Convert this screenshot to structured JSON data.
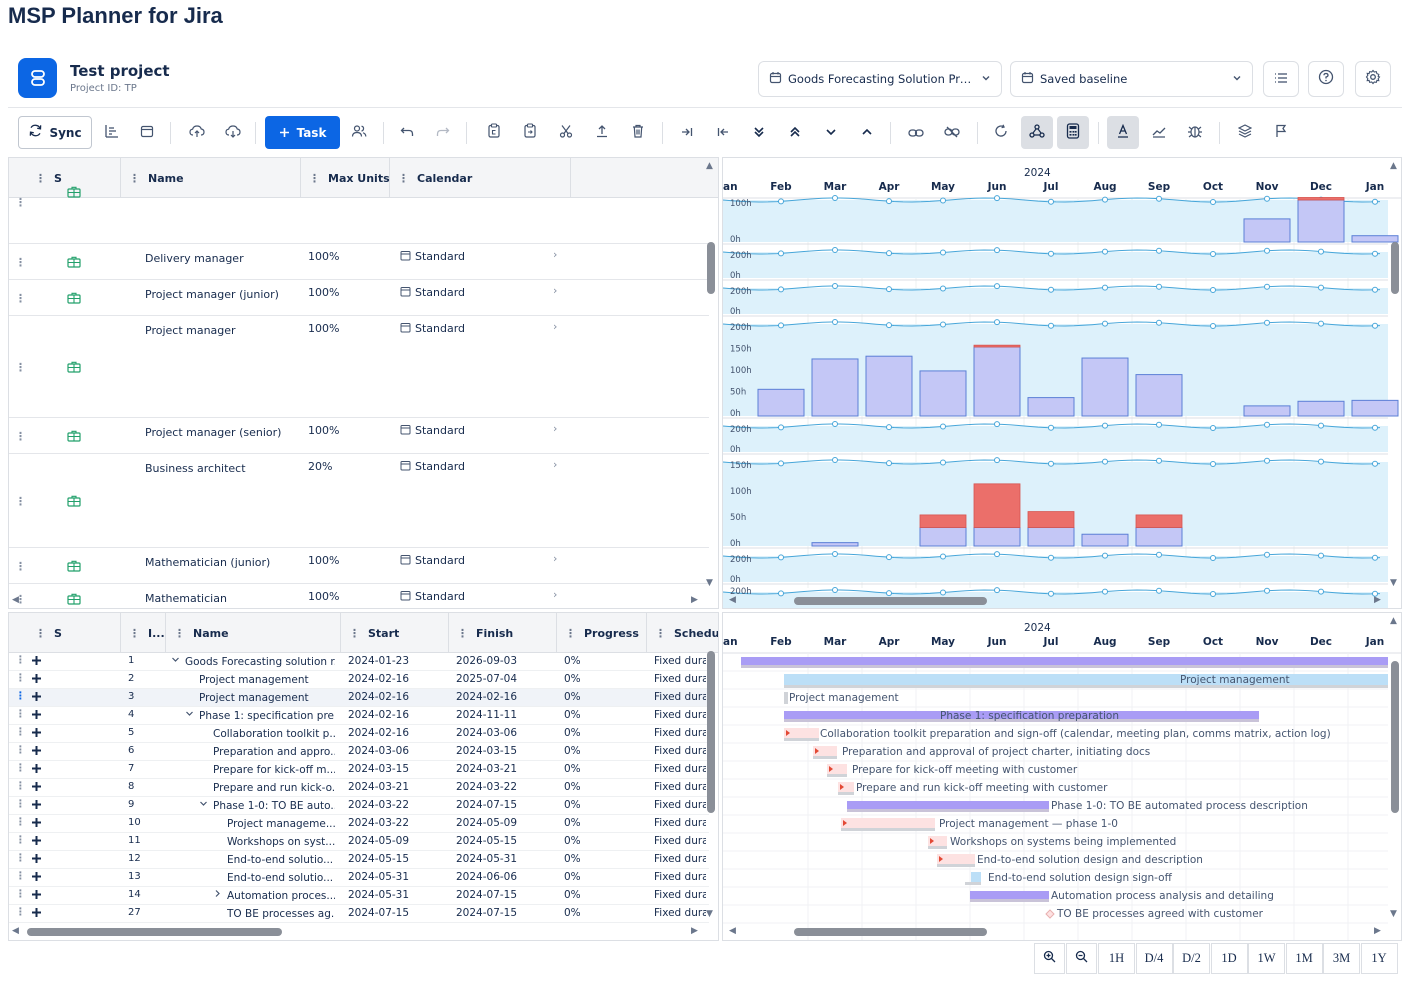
{
  "app": {
    "title": "MSP Planner for Jira"
  },
  "project": {
    "name": "Test project",
    "id_label": "Project ID: TP"
  },
  "selectors": {
    "plan": "Goods Forecasting Solution Proj...",
    "baseline": "Saved baseline"
  },
  "toolbar": {
    "sync_label": "Sync",
    "task_label": "Task"
  },
  "colors": {
    "accent": "#0c66e4",
    "capacity_fill": "#ddf1fb",
    "load_bar": "#c4c7f6",
    "overload": "#eb6f6a",
    "summary_bar": "#a99cf5",
    "task_bar": "#bcdff7"
  },
  "resource_grid": {
    "columns": [
      "S",
      "Name",
      "Max Units",
      "Calendar"
    ],
    "rows": [
      {
        "name": "",
        "units": "",
        "calendar": ""
      },
      {
        "name": "Delivery manager",
        "units": "100%",
        "calendar": "Standard"
      },
      {
        "name": "Project manager (junior)",
        "units": "100%",
        "calendar": "Standard"
      },
      {
        "name": "Project manager",
        "units": "100%",
        "calendar": "Standard"
      },
      {
        "name": "Project manager (senior)",
        "units": "100%",
        "calendar": "Standard"
      },
      {
        "name": "Business architect",
        "units": "20%",
        "calendar": "Standard"
      },
      {
        "name": "Mathematician (junior)",
        "units": "100%",
        "calendar": "Standard"
      },
      {
        "name": "Mathematician",
        "units": "100%",
        "calendar": "Standard"
      }
    ]
  },
  "task_grid": {
    "columns": [
      "S",
      "I...",
      "Name",
      "Start",
      "Finish",
      "Progress",
      "Schedu"
    ],
    "rows": [
      {
        "id": "1",
        "name": "Goods Forecasting solution r...",
        "start": "2024-01-23",
        "finish": "2026-09-03",
        "progress": "0%",
        "sched": "Fixed dura"
      },
      {
        "id": "2",
        "name": "Project management",
        "start": "2024-02-16",
        "finish": "2025-07-04",
        "progress": "0%",
        "sched": "Fixed dura"
      },
      {
        "id": "3",
        "name": "Project management",
        "start": "2024-02-16",
        "finish": "2024-02-16",
        "progress": "0%",
        "sched": "Fixed dura"
      },
      {
        "id": "4",
        "name": "Phase 1: specification pre...",
        "start": "2024-02-16",
        "finish": "2024-11-11",
        "progress": "0%",
        "sched": "Fixed dura"
      },
      {
        "id": "5",
        "name": "Collaboration toolkit p...",
        "start": "2024-02-16",
        "finish": "2024-03-06",
        "progress": "0%",
        "sched": "Fixed dura"
      },
      {
        "id": "6",
        "name": "Preparation and appro...",
        "start": "2024-03-06",
        "finish": "2024-03-15",
        "progress": "0%",
        "sched": "Fixed dura"
      },
      {
        "id": "7",
        "name": "Prepare for kick-off m...",
        "start": "2024-03-15",
        "finish": "2024-03-21",
        "progress": "0%",
        "sched": "Fixed dura"
      },
      {
        "id": "8",
        "name": "Prepare and run kick-o...",
        "start": "2024-03-21",
        "finish": "2024-03-22",
        "progress": "0%",
        "sched": "Fixed dura"
      },
      {
        "id": "9",
        "name": "Phase 1-0: TO BE auto...",
        "start": "2024-03-22",
        "finish": "2024-07-15",
        "progress": "0%",
        "sched": "Fixed dura"
      },
      {
        "id": "10",
        "name": "Project manageme...",
        "start": "2024-03-22",
        "finish": "2024-05-09",
        "progress": "0%",
        "sched": "Fixed dura"
      },
      {
        "id": "11",
        "name": "Workshops on syst...",
        "start": "2024-05-09",
        "finish": "2024-05-15",
        "progress": "0%",
        "sched": "Fixed dura"
      },
      {
        "id": "12",
        "name": "End-to-end solutio...",
        "start": "2024-05-15",
        "finish": "2024-05-31",
        "progress": "0%",
        "sched": "Fixed dura"
      },
      {
        "id": "13",
        "name": "End-to-end solutio...",
        "start": "2024-05-31",
        "finish": "2024-06-06",
        "progress": "0%",
        "sched": "Fixed dura"
      },
      {
        "id": "14",
        "name": "Automation proces...",
        "start": "2024-05-31",
        "finish": "2024-07-15",
        "progress": "0%",
        "sched": "Fixed dura"
      },
      {
        "id": "27",
        "name": "TO BE processes ag...",
        "start": "2024-07-15",
        "finish": "2024-07-15",
        "progress": "0%",
        "sched": "Fixed dura"
      }
    ]
  },
  "timeline": {
    "year": "2024",
    "months_top": [
      "an",
      "Feb",
      "Mar",
      "Apr",
      "May",
      "Jun",
      "Jul",
      "Aug",
      "Sep",
      "Oct",
      "Nov",
      "Dec",
      "Jan"
    ],
    "months_bottom": [
      "an",
      "Feb",
      "Mar",
      "Apr",
      "May",
      "Jun",
      "Jul",
      "Aug",
      "Sep",
      "Oct",
      "Nov",
      "Dec",
      "Jan"
    ]
  },
  "histogram_tracks": [
    {
      "ticks": [
        "100h",
        "0h"
      ],
      "bars": [],
      "tail_bars": [
        {
          "month": 10,
          "load": 0.55
        },
        {
          "month": 11,
          "load": 1.0,
          "over": 0.06
        },
        {
          "month": 12,
          "load": 0.15
        }
      ]
    },
    {
      "ticks": [
        "200h",
        "0h"
      ],
      "bars": []
    },
    {
      "ticks": [
        "200h",
        "0h"
      ],
      "bars": []
    },
    {
      "ticks": [
        "200h",
        "150h",
        "100h",
        "50h",
        "0h"
      ],
      "bars": [
        {
          "month": 1,
          "load": 0.29
        },
        {
          "month": 2,
          "load": 0.62
        },
        {
          "month": 3,
          "load": 0.65
        },
        {
          "month": 4,
          "load": 0.49
        },
        {
          "month": 5,
          "load": 0.75,
          "over": 0.02
        },
        {
          "month": 6,
          "load": 0.2
        },
        {
          "month": 7,
          "load": 0.63
        },
        {
          "month": 8,
          "load": 0.45
        },
        {
          "month": 10,
          "load": 0.11
        },
        {
          "month": 11,
          "load": 0.16
        },
        {
          "month": 12,
          "load": 0.17
        }
      ]
    },
    {
      "ticks": [
        "200h",
        "0h"
      ],
      "bars": []
    },
    {
      "ticks": [
        "150h",
        "100h",
        "50h",
        "0h"
      ],
      "bars": [
        {
          "month": 2,
          "load": 0.04
        },
        {
          "month": 4,
          "load": 0.22,
          "over": 0.15
        },
        {
          "month": 5,
          "load": 0.22,
          "over": 0.52
        },
        {
          "month": 6,
          "load": 0.22,
          "over": 0.19
        },
        {
          "month": 7,
          "load": 0.14
        },
        {
          "month": 8,
          "load": 0.22,
          "over": 0.15
        }
      ]
    },
    {
      "ticks": [
        "200h",
        "0h"
      ],
      "bars": []
    },
    {
      "ticks": [
        "200h"
      ],
      "bars": []
    }
  ],
  "gantt_labels": [
    "Project management",
    "Project management",
    "Phase 1: specification preparation",
    "Collaboration toolkit preparation and sign-off (calendar, meeting plan, comms matrix, action log)",
    "Preparation and approval of project charter, initiating docs",
    "Prepare for kick-off meeting with customer",
    "Prepare and run kick-off meeting with customer",
    "Phase 1-0: TO BE automated process description",
    "Project management — phase 1-0",
    "Workshops on systems being implemented",
    "End-to-end solution design and description",
    "End-to-end solution design sign-off",
    "Automation process analysis and detailing",
    "TO BE processes agreed with customer"
  ],
  "zoom": [
    "1H",
    "D/4",
    "D/2",
    "1D",
    "1W",
    "1M",
    "3M",
    "1Y"
  ]
}
